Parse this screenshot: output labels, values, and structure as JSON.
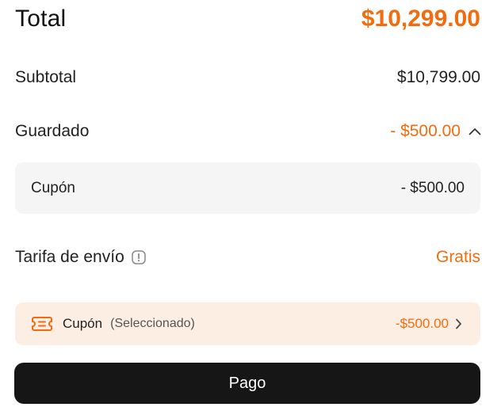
{
  "summary": {
    "total_label": "Total",
    "total_value": "$10,299.00",
    "subtotal_label": "Subtotal",
    "subtotal_value": "$10,799.00",
    "saved_label": "Guardado",
    "saved_value": "- $500.00",
    "coupon_detail_label": "Cupón",
    "coupon_detail_value": "- $500.00",
    "shipping_label": "Tarifa de envío",
    "shipping_value": "Gratis"
  },
  "coupon_bar": {
    "label": "Cupón",
    "status": "(Seleccionado)",
    "value": "-$500.00"
  },
  "pay_button": {
    "label": "Pago"
  },
  "icons": {
    "collapse": "chevron-up-icon",
    "info": "info-icon",
    "coupon": "ticket-icon",
    "navigate": "chevron-right-icon"
  },
  "colors": {
    "accent": "#f26c0f",
    "coupon_bar_bg": "#fdeee4",
    "detail_bg": "#f5f5f5",
    "button_bg": "#161616"
  }
}
